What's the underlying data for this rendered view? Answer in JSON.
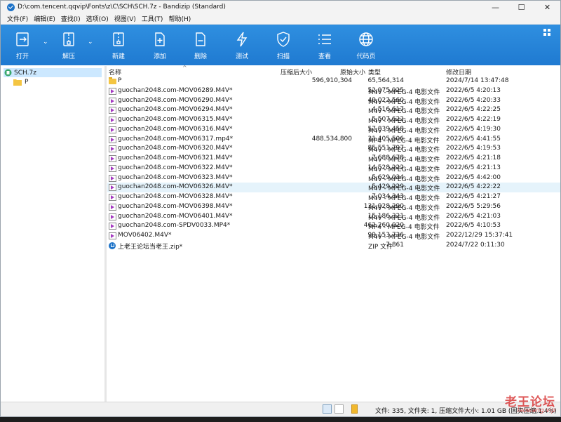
{
  "window": {
    "title": "D:\\com.tencent.qqvip\\Fonts\\z\\C\\SCH\\SCH.7z - Bandizip (Standard)",
    "controls": [
      "—",
      "☐",
      "✕"
    ]
  },
  "menu": [
    "文件(F)",
    "编辑(E)",
    "查找(I)",
    "选项(O)",
    "视图(V)",
    "工具(T)",
    "帮助(H)"
  ],
  "toolbar": {
    "buttons": [
      {
        "label": "打开",
        "icon": "open-icon"
      },
      {
        "label": "解压",
        "icon": "extract-icon"
      },
      {
        "label": "新建",
        "icon": "new-archive-icon"
      },
      {
        "label": "添加",
        "icon": "add-file-icon"
      },
      {
        "label": "删除",
        "icon": "delete-file-icon"
      },
      {
        "label": "测试",
        "icon": "test-icon"
      },
      {
        "label": "扫描",
        "icon": "scan-shield-icon"
      },
      {
        "label": "查看",
        "icon": "view-list-icon"
      },
      {
        "label": "代码页",
        "icon": "codepage-globe-icon"
      }
    ]
  },
  "tree": {
    "root": "SCH.7z",
    "children": [
      "P"
    ]
  },
  "list": {
    "headers": {
      "name": "名称",
      "compressed": "压缩后大小",
      "original": "原始大小",
      "type": "类型",
      "modified": "修改日期"
    },
    "rows": [
      {
        "icon": "folder",
        "name": "P",
        "compressed": "596,910,304",
        "original": "65,564,314",
        "type": "",
        "modified": "2024/7/14 13:47:48"
      },
      {
        "icon": "video",
        "name": "guochan2048.com-MOV06289.M4V*",
        "compressed": "",
        "original": "52,975,925",
        "type": "M4V - MPEG-4 电影文件",
        "modified": "2022/6/5 4:20:13"
      },
      {
        "icon": "video",
        "name": "guochan2048.com-MOV06290.M4V*",
        "compressed": "",
        "original": "49,022,560",
        "type": "M4V - MPEG-4 电影文件",
        "modified": "2022/6/5 4:20:33"
      },
      {
        "icon": "video",
        "name": "guochan2048.com-MOV06294.M4V*",
        "compressed": "",
        "original": "4,516,617",
        "type": "M4V - MPEG-4 电影文件",
        "modified": "2022/6/5 4:22:25"
      },
      {
        "icon": "video",
        "name": "guochan2048.com-MOV06315.M4V*",
        "compressed": "",
        "original": "5,507,622",
        "type": "M4V - MPEG-4 电影文件",
        "modified": "2022/6/5 4:22:19"
      },
      {
        "icon": "video",
        "name": "guochan2048.com-MOV06316.M4V*",
        "compressed": "",
        "original": "57,839,458",
        "type": "M4V - MPEG-4 电影文件",
        "modified": "2022/6/5 4:19:30"
      },
      {
        "icon": "video",
        "name": "guochan2048.com-MOV06317.mp4*",
        "compressed": "488,534,800",
        "original": "31,405,506",
        "type": "MP4 - MPEG-4 电影文件",
        "modified": "2022/6/5 4:41:55"
      },
      {
        "icon": "video",
        "name": "guochan2048.com-MOV06320.M4V*",
        "compressed": "",
        "original": "85,551,797",
        "type": "M4V - MPEG-4 电影文件",
        "modified": "2022/6/5 4:19:53"
      },
      {
        "icon": "video",
        "name": "guochan2048.com-MOV06321.M4V*",
        "compressed": "",
        "original": "7,688,678",
        "type": "M4V - MPEG-4 电影文件",
        "modified": "2022/6/5 4:21:18"
      },
      {
        "icon": "video",
        "name": "guochan2048.com-MOV06322.M4V*",
        "compressed": "",
        "original": "14,528,222",
        "type": "M4V - MPEG-4 电影文件",
        "modified": "2022/6/5 4:21:13"
      },
      {
        "icon": "video",
        "name": "guochan2048.com-MOV06323.M4V*",
        "compressed": "",
        "original": "5,629,034",
        "type": "M4V - MPEG-4 电影文件",
        "modified": "2022/6/5 4:42:00"
      },
      {
        "icon": "video",
        "name": "guochan2048.com-MOV06326.M4V*",
        "compressed": "",
        "original": "5,429,229",
        "type": "M4V - MPEG-4 电影文件",
        "modified": "2022/6/5 4:22:22",
        "selected": true
      },
      {
        "icon": "video",
        "name": "guochan2048.com-MOV06328.M4V*",
        "compressed": "",
        "original": "7,034,343",
        "type": "M4V - MPEG-4 电影文件",
        "modified": "2022/6/5 4:21:27"
      },
      {
        "icon": "video",
        "name": "guochan2048.com-MOV06398.M4V*",
        "compressed": "",
        "original": "131,928,290",
        "type": "M4V - MPEG-4 电影文件",
        "modified": "2022/6/5 5:29:56"
      },
      {
        "icon": "video",
        "name": "guochan2048.com-MOV06401.M4V*",
        "compressed": "",
        "original": "15,186,321",
        "type": "M4V - MPEG-4 电影文件",
        "modified": "2022/6/5 4:21:03"
      },
      {
        "icon": "video",
        "name": "guochan2048.com-SPDV0033.MP4*",
        "compressed": "",
        "original": "462,260,020",
        "type": "MP4 - MPEG-4 电影文件",
        "modified": "2022/6/5 4:10:53"
      },
      {
        "icon": "video",
        "name": "MOV06402.M4V*",
        "compressed": "",
        "original": "99,153,736",
        "type": "M4V - MPEG-4 电影文件",
        "modified": "2022/12/29 15:37:41"
      },
      {
        "icon": "zip",
        "name": "上老王论坛当老王.zip*",
        "compressed": "",
        "original": "7,861",
        "type": "ZIP 文件",
        "modified": "2024/7/22 0:11:30"
      }
    ]
  },
  "status": {
    "text": "文件: 335, 文件夹: 1, 压缩文件大小: 1.01 GB (固实压缩,1.4%)"
  },
  "watermark": {
    "line1": "老王论坛",
    "line2": "laowang.vip"
  },
  "colors": {
    "toolbar": "#2084d6",
    "selection": "#cce8ff"
  }
}
